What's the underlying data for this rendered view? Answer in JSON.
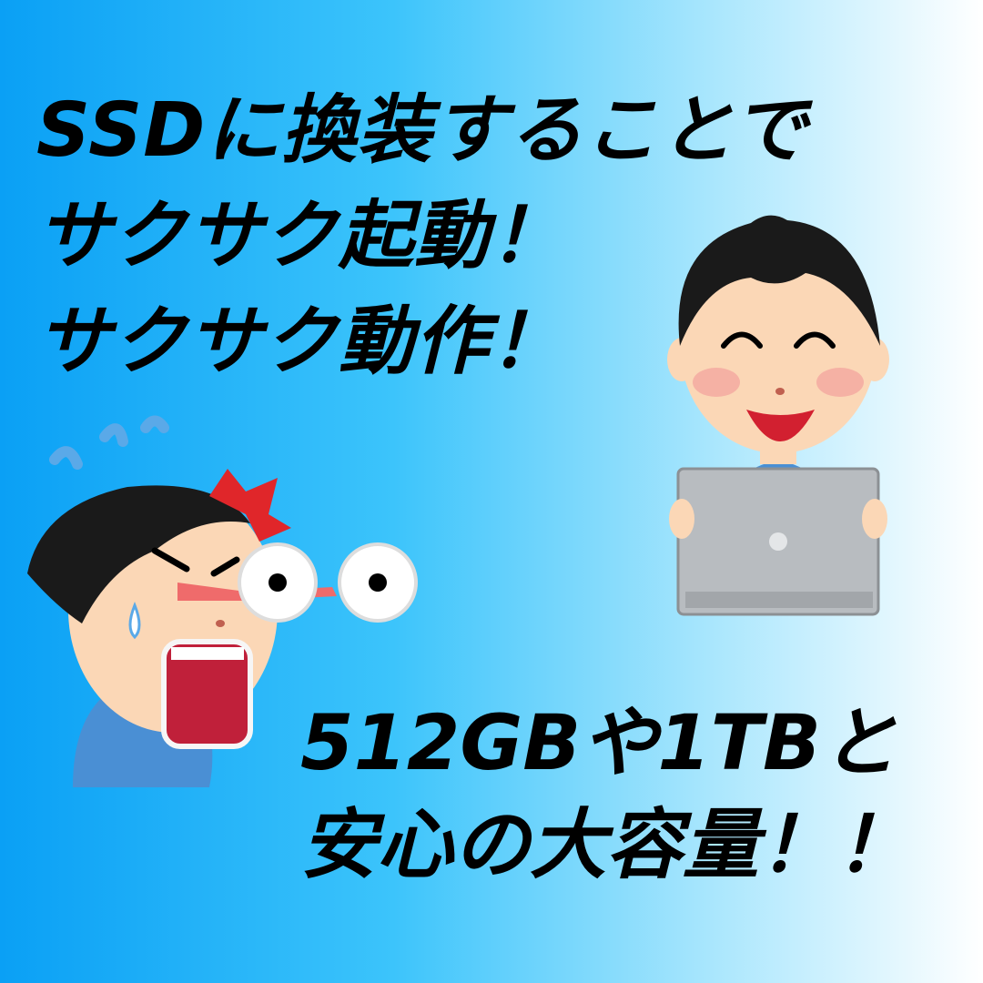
{
  "headline": {
    "line1": "SSDに換装することで",
    "line2": "サクサク起動！",
    "line3": "サクサク動作！"
  },
  "capacity": {
    "line1": "512GBや1TBと",
    "line2": "安心の大容量！！"
  },
  "illustrations": {
    "happy_person": "smiling-man-with-laptop",
    "frustrated_person": "angry-man-with-popping-eyes"
  },
  "colors": {
    "bg_left": "#0aa0f5",
    "bg_right": "#ffffff",
    "text": "#000000",
    "skin": "#fbd7b6",
    "shirt": "#4a8fd4",
    "laptop": "#b8bcc0",
    "anger_mark": "#e0262a"
  }
}
